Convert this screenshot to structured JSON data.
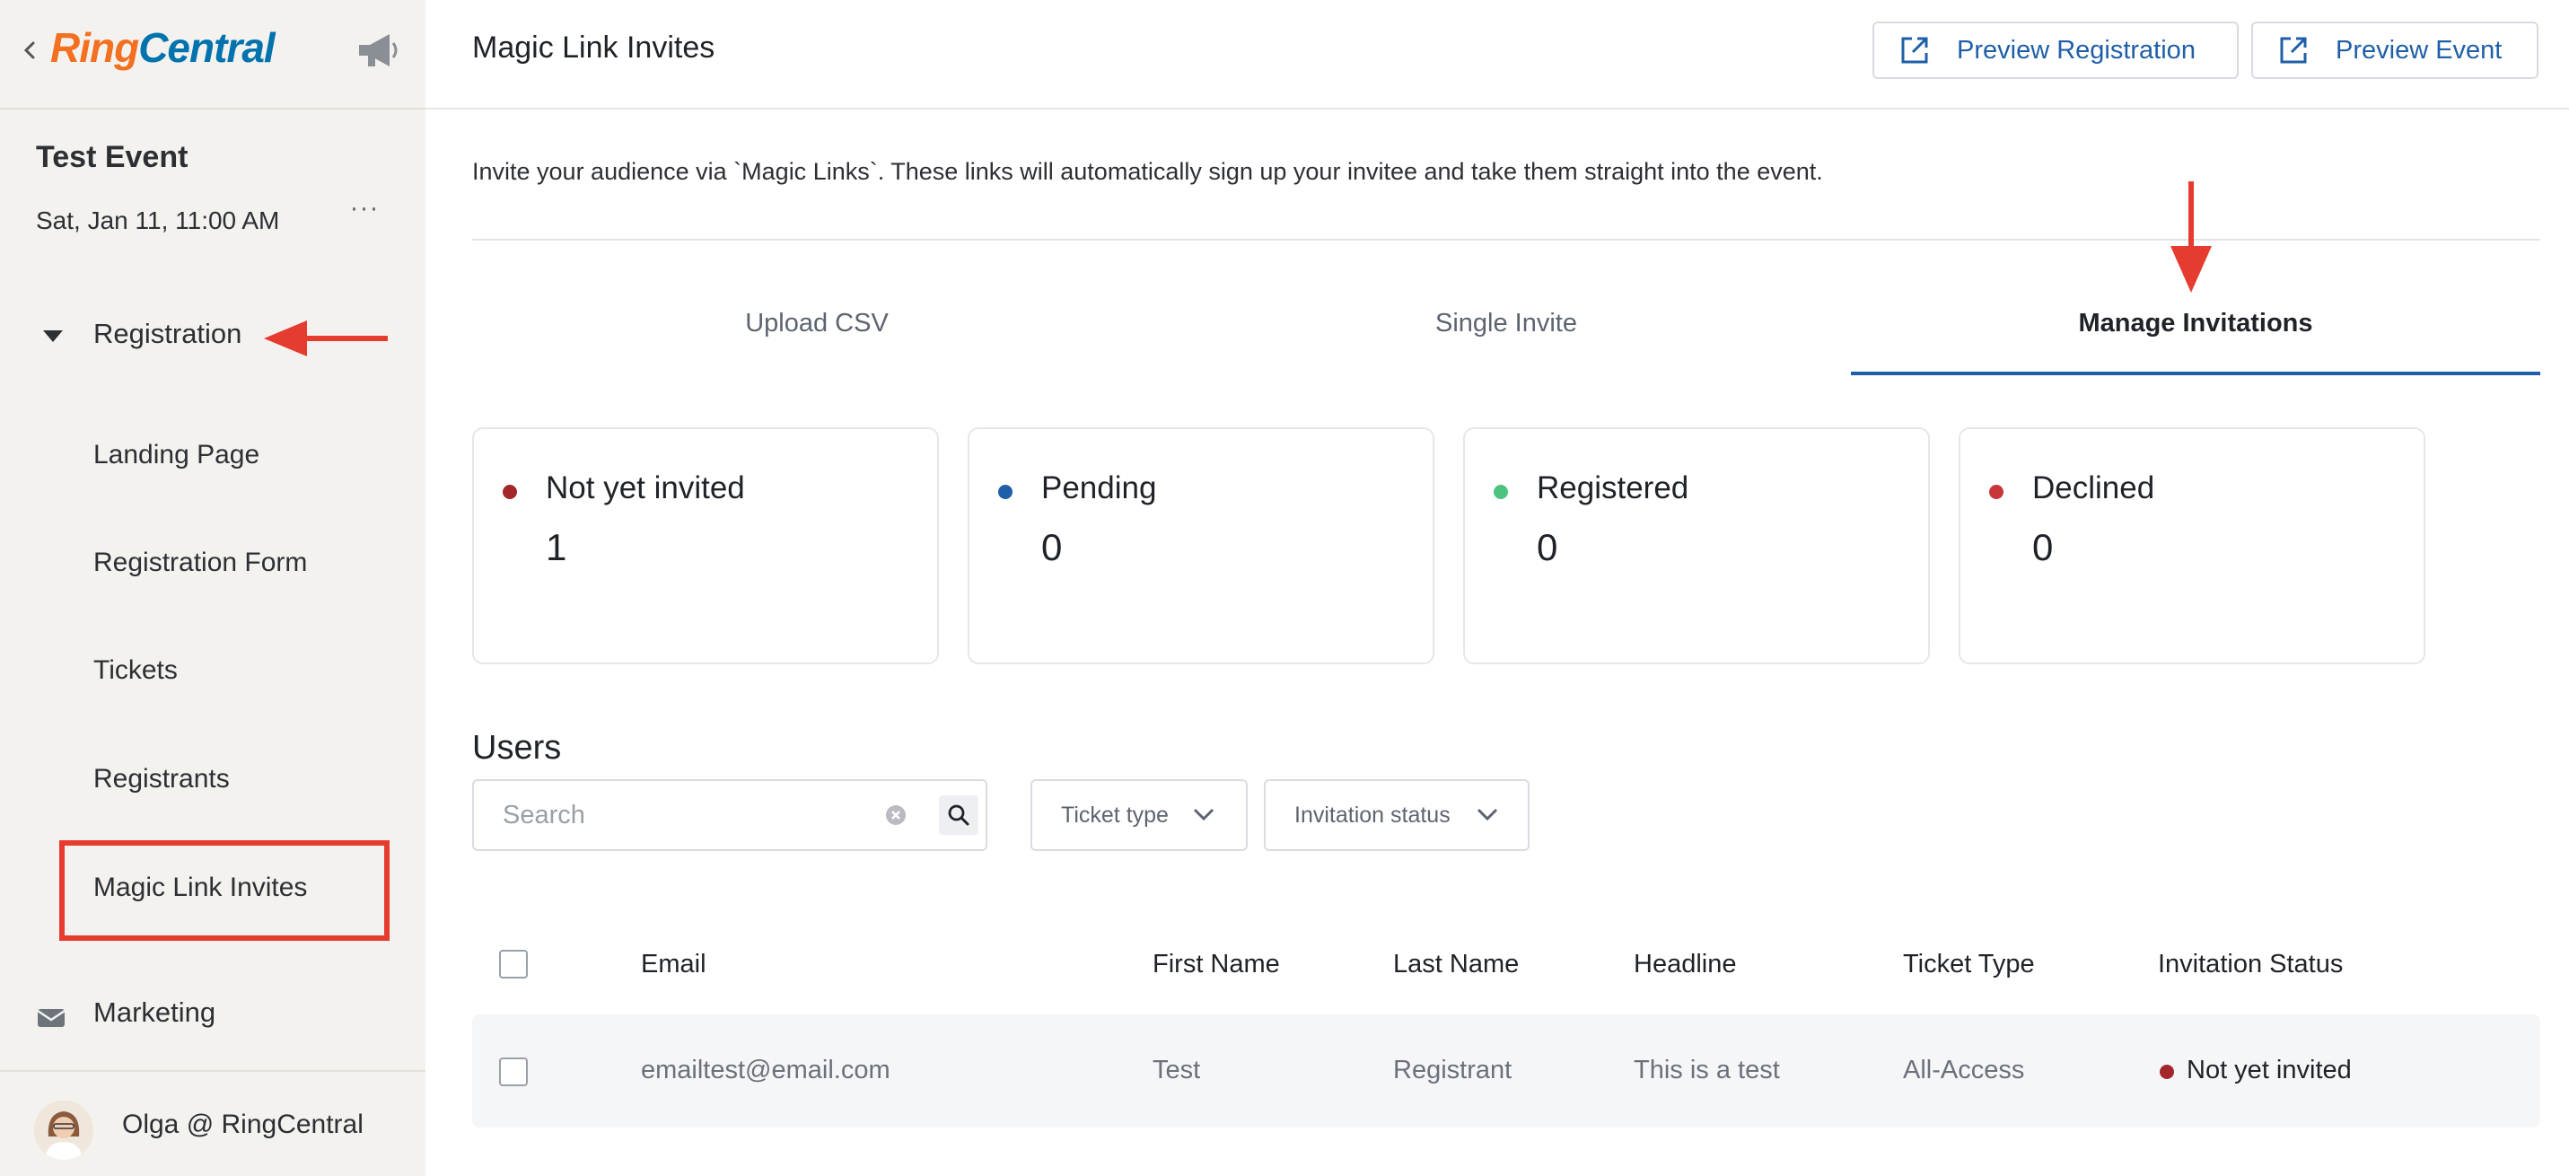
{
  "brand": {
    "ring": "Ring",
    "central": "Central"
  },
  "event": {
    "title": "Test Event",
    "date": "Sat, Jan 11, 11:00 AM",
    "more": "···"
  },
  "nav": {
    "section_label": "Registration",
    "items": [
      {
        "label": "Landing Page"
      },
      {
        "label": "Registration Form"
      },
      {
        "label": "Tickets"
      },
      {
        "label": "Registrants"
      },
      {
        "label": "Magic Link Invites"
      }
    ],
    "marketing_label": "Marketing"
  },
  "user": {
    "name": "Olga @ RingCentral"
  },
  "header": {
    "title": "Magic Link Invites",
    "preview_registration": "Preview Registration",
    "preview_event": "Preview Event"
  },
  "intro": "Invite your audience via `Magic Links`. These links will automatically sign up your invitee and take them straight into the event.",
  "tabs": [
    {
      "label": "Upload CSV"
    },
    {
      "label": "Single Invite"
    },
    {
      "label": "Manage Invitations",
      "active": true
    }
  ],
  "stats": [
    {
      "label": "Not yet invited",
      "value": "1",
      "color": "#a3262a"
    },
    {
      "label": "Pending",
      "value": "0",
      "color": "#1f5fa8"
    },
    {
      "label": "Registered",
      "value": "0",
      "color": "#4cc47f"
    },
    {
      "label": "Declined",
      "value": "0",
      "color": "#c8363a"
    }
  ],
  "users": {
    "title": "Users",
    "search_placeholder": "Search",
    "filter_ticket": "Ticket type",
    "filter_status": "Invitation status",
    "columns": [
      "Email",
      "First Name",
      "Last Name",
      "Headline",
      "Ticket Type",
      "Invitation Status"
    ],
    "rows": [
      {
        "email": "emailtest@email.com",
        "first_name": "Test",
        "last_name": "Registrant",
        "headline": "This is a test",
        "ticket_type": "All-Access",
        "status": "Not yet invited",
        "status_color": "#a3262a"
      }
    ]
  },
  "annotation_color": "#e53c2f",
  "accent_color": "#1f5fa8"
}
